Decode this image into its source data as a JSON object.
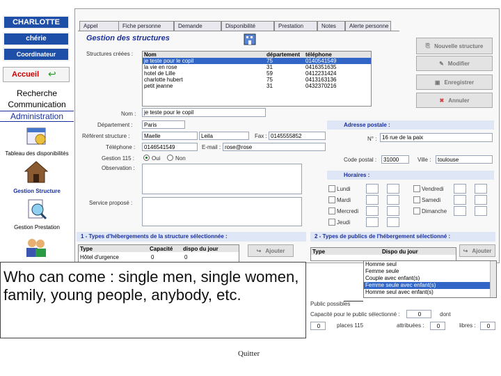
{
  "sidebar": {
    "user_name": "CHARLOTTE",
    "user_nick": "chérie",
    "role": "Coordinateur",
    "home": "Accueil",
    "recherche": "Recherche",
    "communication": "Communication",
    "administration": "Administration",
    "tableau": "Tableau des disponibilités",
    "gestion_structure": "Gestion Structure",
    "gestion_prestation": "Gestion Prestation"
  },
  "tabs": [
    "Appel",
    "Fiche personne",
    "Demande",
    "Disponibilité",
    "Prestation",
    "Notes",
    "Alerte personne"
  ],
  "title": "Gestion des structures",
  "structures": {
    "label": "Structures créées :",
    "headers": [
      "Nom",
      "département",
      "téléphone"
    ],
    "rows": [
      [
        "je teste pour le copil",
        "75",
        "0140541549"
      ],
      [
        "la vie en rose",
        "31",
        "0416351635"
      ],
      [
        "hotel de Lille",
        "59",
        "0412231424"
      ],
      [
        "charlotte hubert",
        "75",
        "0413163136"
      ],
      [
        "petit jeanne",
        "31",
        "0432370216"
      ]
    ]
  },
  "buttons": {
    "new": "Nouvelle structure",
    "edit": "Modifier",
    "save": "Enregistrer",
    "cancel": "Annuler",
    "add1": "Ajouter",
    "add2": "Ajouter"
  },
  "form": {
    "nom_label": "Nom :",
    "nom": "je teste pour le copil",
    "dept_label": "Département :",
    "dept": "Paris",
    "ref_label": "Référent structure :",
    "ref_last": "Maelle",
    "ref_first": "Leila",
    "fax_label": "Fax :",
    "fax": "0145555852",
    "tel_label": "Téléphone :",
    "tel": "0146541549",
    "email_label": "E-mail :",
    "email": "rose@rose",
    "q115_label": "Gestion 115 :",
    "oui": "Oui",
    "non": "Non",
    "obs_label": "Observation :",
    "service_label": "Service proposé :"
  },
  "adresse": {
    "header": "Adresse postale :",
    "n_label": "N° :",
    "street": "16 rue de la paix",
    "cp_label": "Code postal :",
    "cp": "31000",
    "ville_label": "Ville :",
    "ville": "toulouse"
  },
  "horaires": {
    "header": "Horaires :",
    "days": [
      "Lundi",
      "Mardi",
      "Mercredi",
      "Jeudi",
      "Vendredi",
      "Samedi",
      "Dimanche"
    ]
  },
  "panel1": {
    "header": "1 - Types d'hébergements de la structure sélectionnée :",
    "col_type": "Type",
    "col_cap": "Capacité",
    "col_dispo": "dispo du jour",
    "row": [
      "Hôtel d'urgence",
      "0",
      "0"
    ]
  },
  "panel2": {
    "header": "2 - Types de publics de l'hébergement sélectionné :",
    "col_type": "Type",
    "col_dispo": "Dispo du jour",
    "options": [
      "Homme seul",
      "Femme seule",
      "Couple avec enfant(s)",
      "Femme seule avec enfant(s)",
      "Homme seul avec enfant(s)"
    ],
    "public_label": "Public possibles",
    "capacity_label": "Capacité pour le public sélectionné :",
    "capacity": "0",
    "dont": "dont",
    "places_label": "places 115",
    "places": "0",
    "attrib_label": "attribuées :",
    "attrib": "0",
    "libres_label": "libres :",
    "libres": "0"
  },
  "callout": "Who can come : single men, single women, family, young people, anybody, etc.",
  "quit": "Quitter",
  "colors": {
    "navy": "#1d4ea8",
    "header_bg": "#dfe6f5",
    "selection": "#3166c6"
  }
}
